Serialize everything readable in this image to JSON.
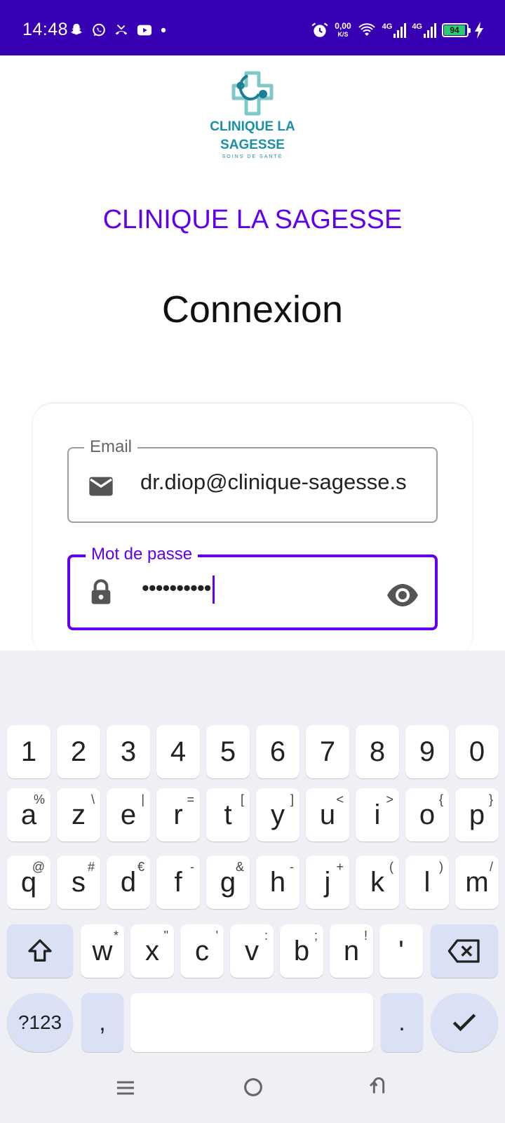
{
  "status_bar": {
    "time": "14:48",
    "net_speed": "0,00",
    "net_speed_unit": "K/S",
    "signal_1": "4G",
    "signal_2": "4G",
    "battery": "94"
  },
  "logo": {
    "line1": "CLINIQUE LA",
    "line2": "SAGESSE",
    "tagline": "SOINS DE SANTÉ"
  },
  "brand_title": "CLINIQUE LA SAGESSE",
  "page_title": "Connexion",
  "form": {
    "email": {
      "label": "Email",
      "value": "dr.diop@clinique-sagesse.s"
    },
    "password": {
      "label": "Mot de passe",
      "value": "••••••••••"
    }
  },
  "keyboard": {
    "row_numbers": [
      "1",
      "2",
      "3",
      "4",
      "5",
      "6",
      "7",
      "8",
      "9",
      "0"
    ],
    "row1": [
      {
        "k": "a",
        "h": "%"
      },
      {
        "k": "z",
        "h": "\\"
      },
      {
        "k": "e",
        "h": "|"
      },
      {
        "k": "r",
        "h": "="
      },
      {
        "k": "t",
        "h": "["
      },
      {
        "k": "y",
        "h": "]"
      },
      {
        "k": "u",
        "h": "<"
      },
      {
        "k": "i",
        "h": ">"
      },
      {
        "k": "o",
        "h": "{"
      },
      {
        "k": "p",
        "h": "}"
      }
    ],
    "row2": [
      {
        "k": "q",
        "h": "@"
      },
      {
        "k": "s",
        "h": "#"
      },
      {
        "k": "d",
        "h": "€"
      },
      {
        "k": "f",
        "h": "-"
      },
      {
        "k": "g",
        "h": "&"
      },
      {
        "k": "h",
        "h": "-"
      },
      {
        "k": "j",
        "h": "+"
      },
      {
        "k": "k",
        "h": "("
      },
      {
        "k": "l",
        "h": ")"
      },
      {
        "k": "m",
        "h": "/"
      }
    ],
    "row3": [
      {
        "k": "w",
        "h": "*"
      },
      {
        "k": "x",
        "h": "\""
      },
      {
        "k": "c",
        "h": "'"
      },
      {
        "k": "v",
        "h": ":"
      },
      {
        "k": "b",
        "h": ";"
      },
      {
        "k": "n",
        "h": "!"
      },
      {
        "k": "'",
        "h": ""
      }
    ],
    "symbols_label": "?123",
    "comma_label": ",",
    "period_label": "."
  },
  "colors": {
    "accent": "#6200ee",
    "status_bar": "#3700b3",
    "logo": "#1b8fa7"
  }
}
